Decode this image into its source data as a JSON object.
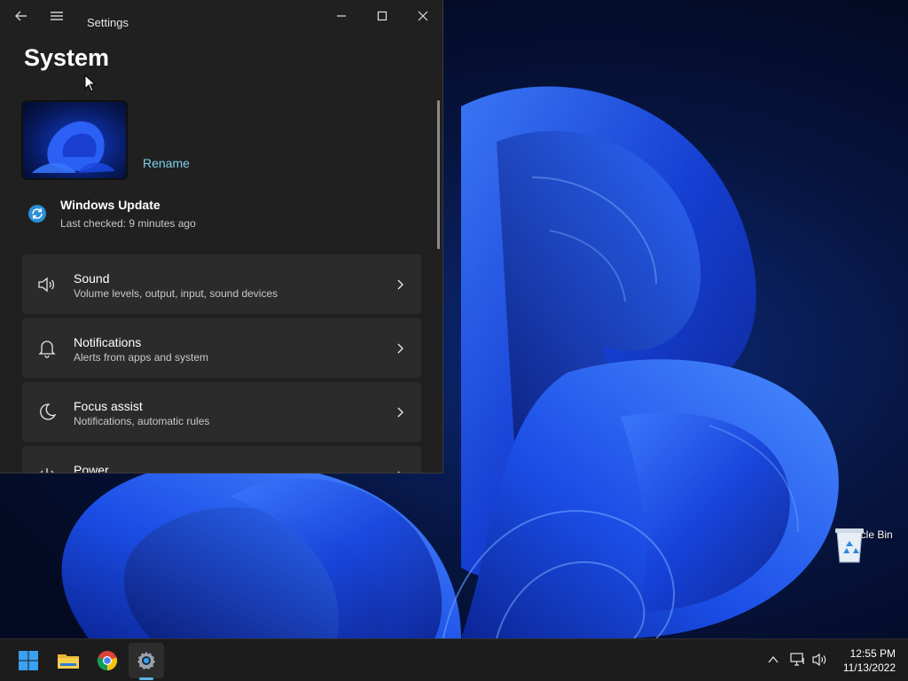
{
  "desktop": {
    "recycle_bin_label": "Recycle Bin"
  },
  "window": {
    "title": "Settings",
    "page_title": "System",
    "rename_label": "Rename",
    "update": {
      "title": "Windows Update",
      "subtitle": "Last checked: 9 minutes ago"
    },
    "items": [
      {
        "title": "Sound",
        "subtitle": "Volume levels, output, input, sound devices",
        "icon": "speaker-icon"
      },
      {
        "title": "Notifications",
        "subtitle": "Alerts from apps and system",
        "icon": "bell-icon"
      },
      {
        "title": "Focus assist",
        "subtitle": "Notifications, automatic rules",
        "icon": "moon-icon"
      },
      {
        "title": "Power",
        "subtitle": "",
        "icon": "power-icon"
      }
    ]
  },
  "taskbar": {
    "apps": [
      "windows-start-icon",
      "file-explorer-icon",
      "chrome-icon",
      "settings-gear-icon"
    ],
    "time": "12:55 PM",
    "date": "11/13/2022"
  },
  "colors": {
    "accent": "#7fd0e8",
    "window_bg": "#202020",
    "card_bg": "#2b2b2b",
    "taskbar_bg": "#1c1c1c",
    "wallpaper_blue": "#1a47d8"
  }
}
